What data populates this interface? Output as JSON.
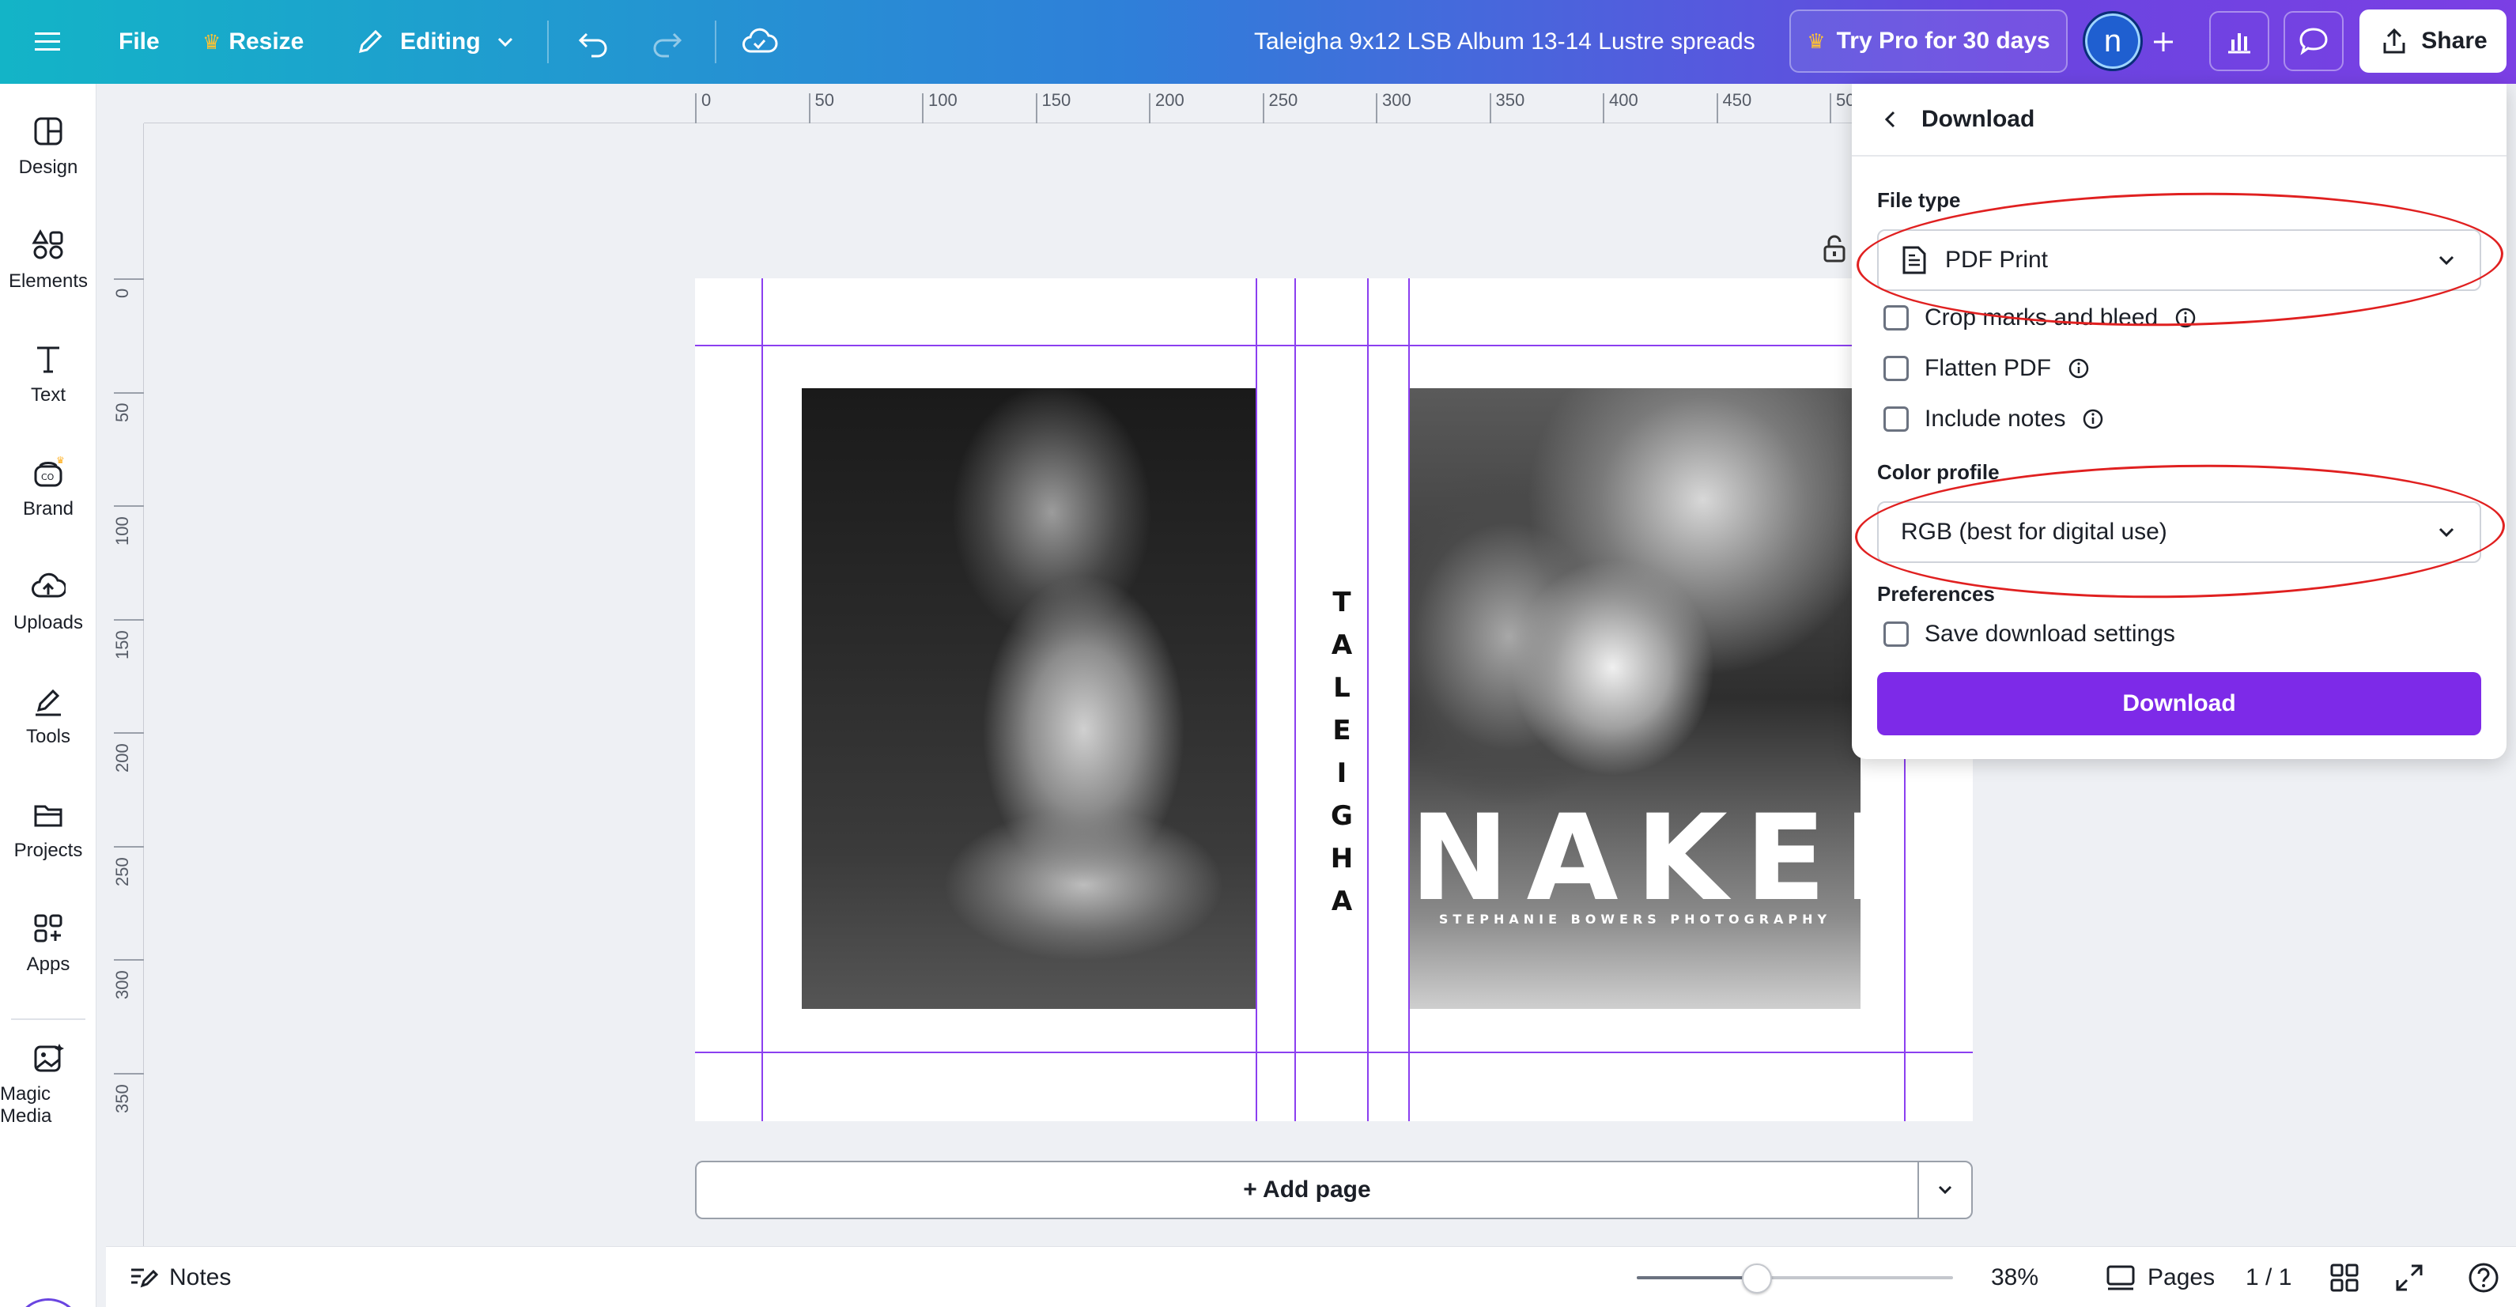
{
  "topbar": {
    "menu_icon": "hamburger-icon",
    "file_label": "File",
    "resize_label": "Resize",
    "editing_label": "Editing",
    "doc_title": "Taleigha 9x12 LSB Album 13-14 Lustre spreads",
    "pro_label": "Try Pro for 30 days",
    "avatar_initial": "n",
    "share_label": "Share"
  },
  "sidebar": {
    "items": [
      {
        "label": "Design",
        "icon": "design-icon"
      },
      {
        "label": "Elements",
        "icon": "elements-icon"
      },
      {
        "label": "Text",
        "icon": "text-icon"
      },
      {
        "label": "Brand",
        "icon": "brand-icon"
      },
      {
        "label": "Uploads",
        "icon": "uploads-icon"
      },
      {
        "label": "Tools",
        "icon": "tools-icon"
      },
      {
        "label": "Projects",
        "icon": "projects-icon"
      },
      {
        "label": "Apps",
        "icon": "apps-icon"
      },
      {
        "label": "Magic Media",
        "icon": "magic-media-icon"
      }
    ]
  },
  "ruler": {
    "horizontal": [
      "0",
      "50",
      "100",
      "150",
      "200",
      "250",
      "300",
      "350",
      "400",
      "450",
      "50"
    ],
    "vertical": [
      "0",
      "50",
      "100",
      "150",
      "200",
      "250",
      "300",
      "350"
    ]
  },
  "canvas": {
    "spine_text": "TALEIGHA",
    "cover_title": "NAKED",
    "cover_subtitle": "STEPHANIE BOWERS PHOTOGRAPHY"
  },
  "add_page_label": "+ Add page",
  "bottombar": {
    "notes_label": "Notes",
    "zoom_level": 38,
    "zoom_label": "38%",
    "pages_label": "Pages",
    "page_counter": "1 / 1"
  },
  "download_panel": {
    "title": "Download",
    "file_type_label": "File type",
    "file_type_value": "PDF Print",
    "options": [
      {
        "label": "Crop marks and bleed",
        "checked": false,
        "info": true
      },
      {
        "label": "Flatten PDF",
        "checked": false,
        "info": true
      },
      {
        "label": "Include notes",
        "checked": false,
        "info": true
      }
    ],
    "color_profile_label": "Color profile",
    "color_profile_value": "RGB (best for digital use)",
    "preferences_label": "Preferences",
    "save_settings_label": "Save download settings",
    "download_button": "Download"
  },
  "colors": {
    "accent": "#7d2ae8",
    "guide": "#8b3ff0",
    "annotation": "#e02020"
  }
}
